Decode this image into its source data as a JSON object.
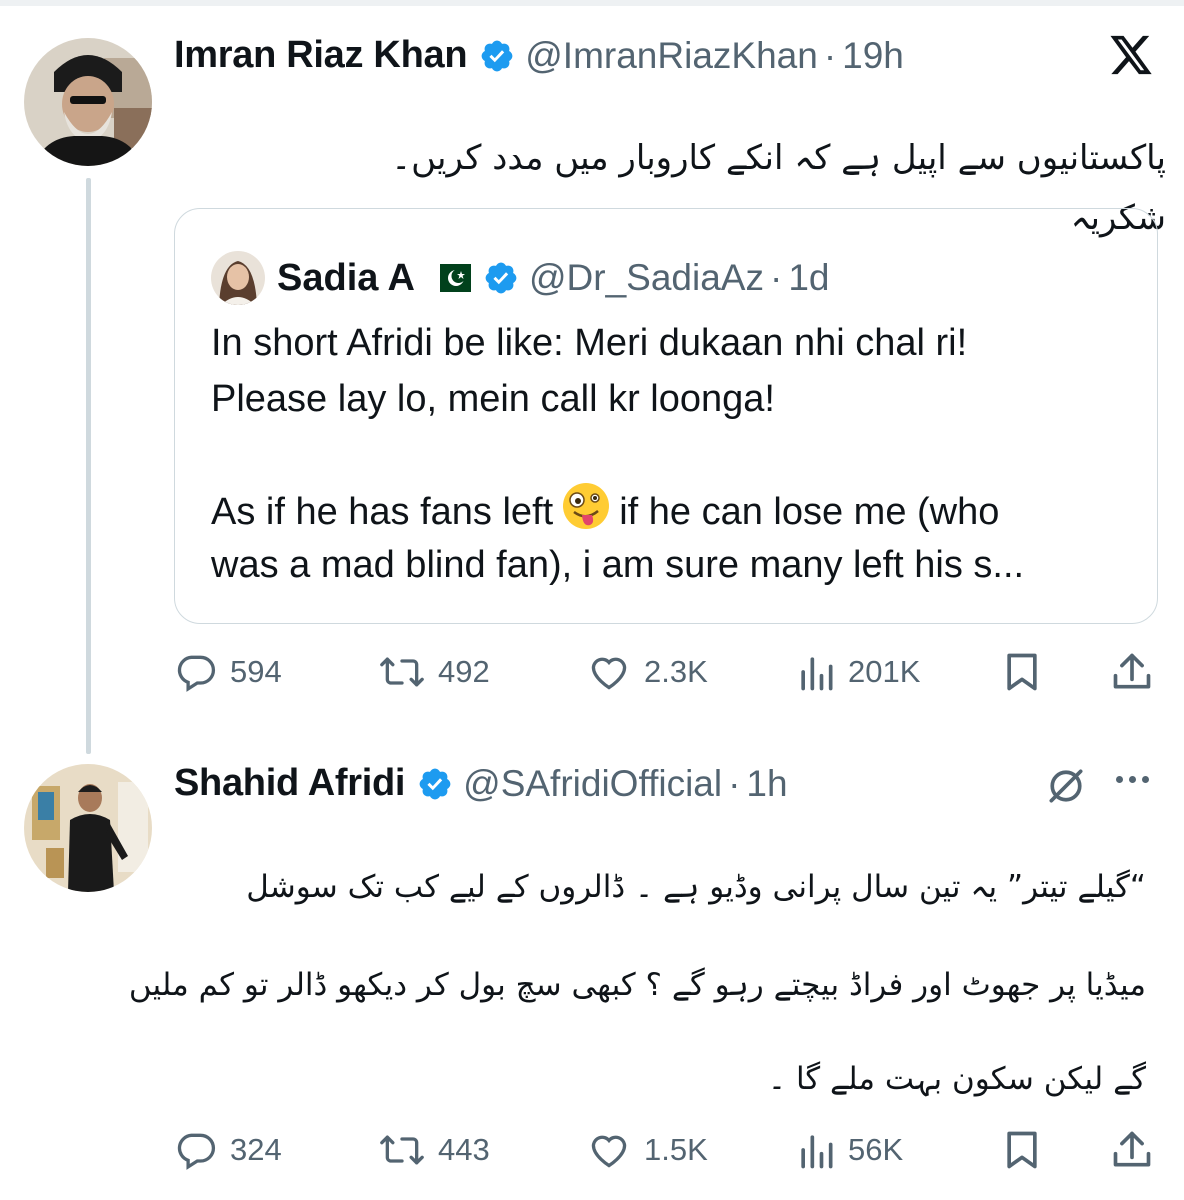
{
  "thread": [
    {
      "author": {
        "name": "Imran Riaz Khan",
        "handle": "@ImranRiazKhan",
        "time": "19h",
        "verified": true
      },
      "text_lines": [
        "پاکستانیوں سے اپیل ہے کہ انکے کاروبار میں مدد کریں۔ شکریہ"
      ],
      "quote": {
        "author": {
          "name": "Sadia A",
          "flag": "pakistan-flag",
          "handle": "@Dr_SadiaAz",
          "time": "1d",
          "verified": true
        },
        "line1": "In short Afridi be like: Meri dukaan nhi chal ri!",
        "line2": "Please lay lo, mein call kr loonga!",
        "line3a": "As if he has fans left",
        "emoji": "zany-face-emoji",
        "line3b": "if he can lose me (who",
        "line4": "was a mad blind fan), i am sure many left his s..."
      },
      "stats": {
        "replies": "594",
        "reposts": "492",
        "likes": "2.3K",
        "views": "201K"
      }
    },
    {
      "author": {
        "name": "Shahid Afridi",
        "handle": "@SAfridiOfficial",
        "time": "1h",
        "verified": true
      },
      "text_lines": [
        "“گیلے تیتر” یہ تین سال پرانی وڈیو ہے ۔ ڈالروں کے لیے کب تک سوشل",
        "میڈیا پر جھوٹ اور فراڈ بیچتے رہو گے ؟ کبھی سچ بول کر دیکھو ڈالر تو کم ملیں",
        "گے لیکن سکون بہت ملے گا ۔"
      ],
      "stats": {
        "replies": "324",
        "reposts": "443",
        "likes": "1.5K",
        "views": "56K"
      }
    }
  ],
  "icons": {
    "brand": "x-logo-icon",
    "verified_color": "#1d9bf0",
    "muted_color": "#536471"
  }
}
